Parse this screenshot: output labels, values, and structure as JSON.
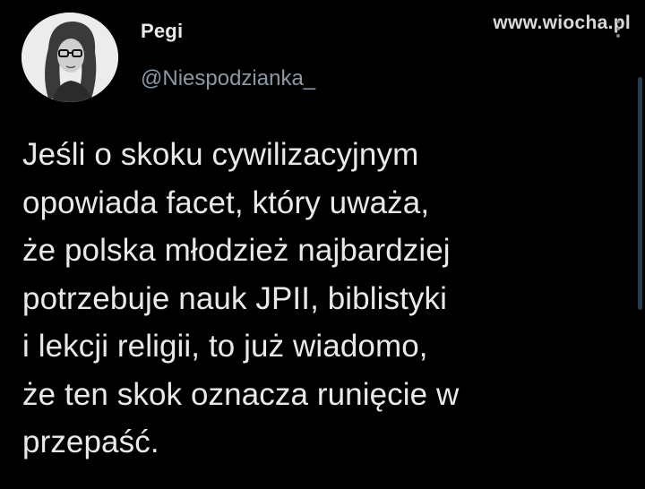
{
  "watermark": "www.wiocha.pl",
  "author": {
    "display_name": "Pegi",
    "handle": "@Niespodzianka_"
  },
  "tweet": {
    "lines": [
      "Jeśli o skoku cywilizacyjnym",
      "opowiada facet, który uważa,",
      "że polska młodzież najbardziej",
      "potrzebuje nauk JPII, biblistyki",
      "i lekcji religii, to już wiadomo,",
      "że ten skok oznacza runięcie w",
      "przepaść."
    ]
  },
  "icons": {
    "avatar": "profile-photo",
    "more": "more-vertical-icon"
  },
  "colors": {
    "background": "#000000",
    "text": "#e7e9ea",
    "secondary": "#8b98a5"
  }
}
